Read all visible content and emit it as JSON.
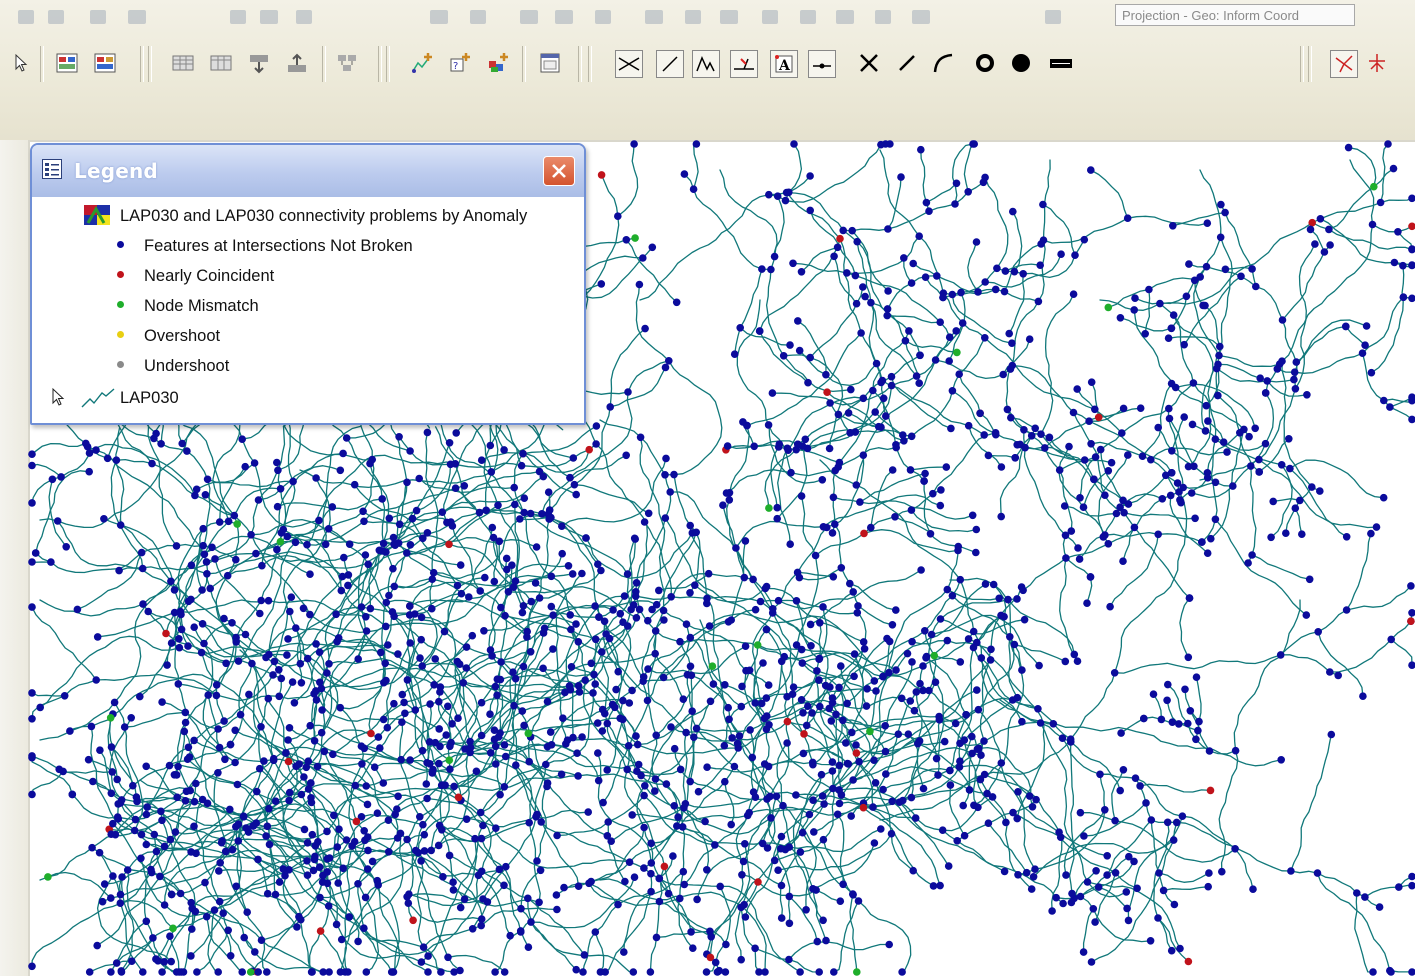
{
  "toolbar": {
    "coordinate_display": "Projection - Geo: Inform Coord",
    "buttons": [
      {
        "icon": "select-pointer-icon"
      },
      {
        "icon": "new-connectivity-icon"
      },
      {
        "icon": "connectivity-rules-icon"
      },
      {
        "icon": "table-view-icon"
      },
      {
        "icon": "attribute-table-icon"
      },
      {
        "icon": "import-icon"
      },
      {
        "icon": "export-icon"
      },
      {
        "icon": "topology-icon"
      },
      {
        "icon": "add-feature-icon"
      },
      {
        "icon": "add-point-icon"
      },
      {
        "icon": "add-group-icon"
      },
      {
        "icon": "properties-icon"
      },
      {
        "icon": "intersection-tool-icon"
      },
      {
        "icon": "line-tool-icon"
      },
      {
        "icon": "vertex-tool-icon"
      },
      {
        "icon": "snap-tool-icon"
      },
      {
        "icon": "label-tool-icon"
      },
      {
        "icon": "node-tool-icon"
      },
      {
        "icon": "cross-icon"
      },
      {
        "icon": "slash-line-icon"
      },
      {
        "icon": "curve-icon"
      },
      {
        "icon": "ring-icon"
      },
      {
        "icon": "filled-dot-icon"
      },
      {
        "icon": "double-line-icon"
      },
      {
        "icon": "trace-icon"
      },
      {
        "icon": "network-icon"
      }
    ]
  },
  "legend": {
    "title": "Legend",
    "group_label": "LAP030 and LAP030 connectivity problems by Anomaly",
    "classes": [
      {
        "label": "Features at Intersections Not Broken",
        "color": "#0b0b9c"
      },
      {
        "label": "Nearly Coincident",
        "color": "#c0131b"
      },
      {
        "label": "Node Mismatch",
        "color": "#1fae2b"
      },
      {
        "label": "Overshoot",
        "color": "#e8cf12"
      },
      {
        "label": "Undershoot",
        "color": "#8a8a8a"
      }
    ],
    "line_layer_label": "LAP030"
  },
  "map": {
    "line_color": "#11787a",
    "point_color": "#0b0b9c",
    "error_point_color": "#c0131b",
    "mismatch_point_color": "#1fae2b"
  }
}
